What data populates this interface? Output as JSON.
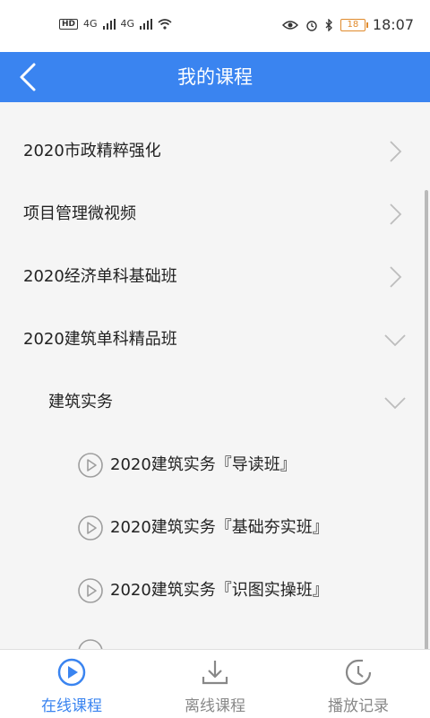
{
  "status": {
    "time": "18:07",
    "battery": "18",
    "net_type_1": "4G",
    "net_type_2": "4G",
    "hd": "HD"
  },
  "header": {
    "title": "我的课程"
  },
  "rows": [
    {
      "label": "2020市政精粹强化",
      "kind": "course",
      "chevron": "right"
    },
    {
      "label": "项目管理微视频",
      "kind": "course",
      "chevron": "right"
    },
    {
      "label": "2020经济单科基础班",
      "kind": "course",
      "chevron": "right"
    },
    {
      "label": "2020建筑单科精品班",
      "kind": "course",
      "chevron": "down"
    },
    {
      "label": "建筑实务",
      "kind": "subject",
      "chevron": "down"
    },
    {
      "label": "2020建筑实务『导读班』",
      "kind": "lesson"
    },
    {
      "label": "2020建筑实务『基础夯实班』",
      "kind": "lesson"
    },
    {
      "label": "2020建筑实务『识图实操班』",
      "kind": "lesson"
    }
  ],
  "tabs": [
    {
      "label": "在线课程",
      "icon": "play-circle-icon",
      "active": true
    },
    {
      "label": "离线课程",
      "icon": "download-icon",
      "active": false
    },
    {
      "label": "播放记录",
      "icon": "history-clock-icon",
      "active": false
    }
  ],
  "colors": {
    "primary": "#3a84f0",
    "background": "#f5f5f5",
    "inactive": "#888888"
  }
}
